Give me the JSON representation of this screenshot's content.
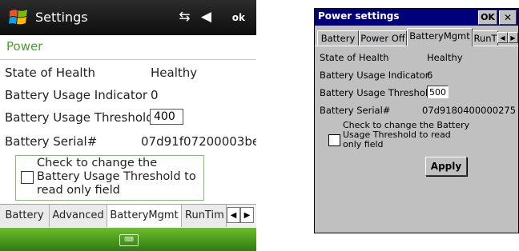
{
  "wm": {
    "title": "Settings",
    "status_icons": "⇆ ◀",
    "ok_label": "ok",
    "header": "Power",
    "rows": [
      {
        "label": "State of Health",
        "value": "Healthy"
      },
      {
        "label": "Battery Usage Indicator",
        "value": "0"
      },
      {
        "label": "Battery Usage Threshold",
        "value": "400"
      },
      {
        "label": "Battery Serial#",
        "value": "07d91f07200003be"
      }
    ],
    "checkbox_label": "Check to change the Battery Usage Threshold to read only field",
    "tabs": [
      "Battery",
      "Advanced",
      "BatteryMgmt",
      "RunTim"
    ],
    "arrows": {
      "left": "◀",
      "right": "▶"
    },
    "keyboard_icon": "⌨",
    "accent_color": "#4aa02c"
  },
  "ce": {
    "title": "Power settings",
    "ok_label": "OK",
    "close_label": "✕",
    "tabs": [
      "Battery",
      "Power Off",
      "BatteryMgmt",
      "RunT"
    ],
    "arrows": {
      "left": "◀",
      "right": "▶"
    },
    "rows": [
      {
        "label": "State of Health",
        "value": "Healthy"
      },
      {
        "label": "Battery Usage Indicator",
        "value": "6"
      },
      {
        "label": "Battery Usage Threshold",
        "value": "500"
      },
      {
        "label": "Battery Serial#",
        "value": "07d9180400000275"
      }
    ],
    "checkbox_label": "Check to change the Battery Usage Threshold to read only field",
    "apply_label": "Apply",
    "titlebar_color": "#00007b"
  }
}
